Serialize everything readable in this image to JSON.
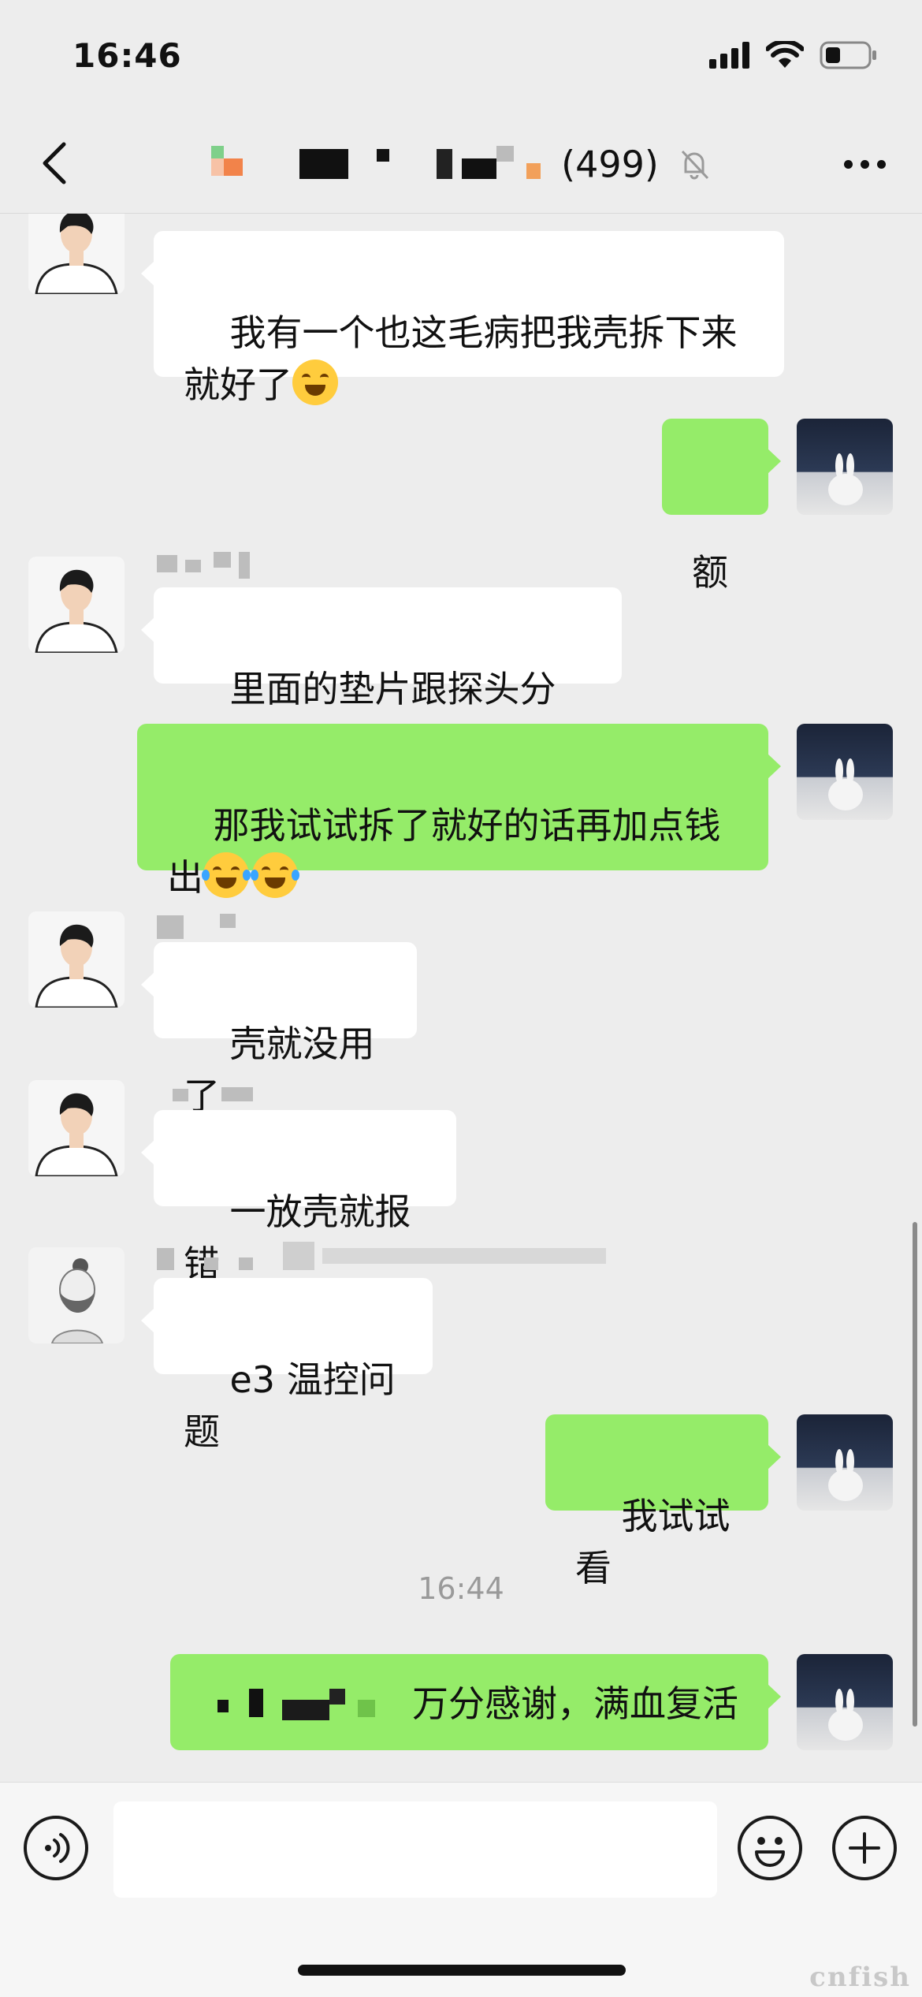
{
  "status_bar": {
    "time": "16:46"
  },
  "header": {
    "member_count": "(499)"
  },
  "messages": [
    {
      "text": "我有一个也这毛病把我壳拆下来\n就好了"
    },
    {
      "text": "额"
    },
    {
      "text": "里面的垫片跟探头分开"
    },
    {
      "text": "那我试试拆了就好的话再加点钱\n出"
    },
    {
      "text": "壳就没用了"
    },
    {
      "text": "一放壳就报错"
    },
    {
      "text": "e3 温控问题"
    },
    {
      "text": "我试试看"
    },
    {
      "text": "万分感谢，满血复活"
    }
  ],
  "timestamp": "16:44",
  "input": {
    "value": ""
  },
  "watermark": "cnfish"
}
